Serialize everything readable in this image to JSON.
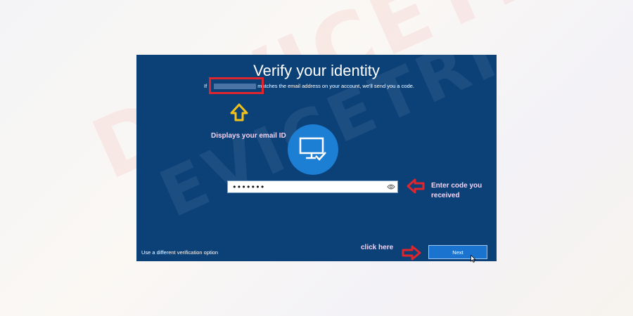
{
  "page": {
    "watermark": "DEVICETRICKS",
    "screen_watermark": "EVICETRICKS"
  },
  "dialog": {
    "title": "Verify your identity",
    "subtitle_prefix": "If",
    "subtitle_suffix": "matches the email address on your account, we'll send you a code.",
    "code_value": "•••••••",
    "alt_option": "Use a different verification option",
    "next_label": "Next"
  },
  "annotations": {
    "email_note": "Displays your email ID",
    "code_note": "Enter code you received",
    "click_note": "click here"
  },
  "icons": {
    "center": "monitor-check-icon",
    "field": "eye-icon",
    "up_arrow": "arrow-up-icon",
    "code_arrow": "arrow-left-icon",
    "next_arrow": "arrow-right-icon",
    "pointer": "mouse-cursor-icon"
  },
  "colors": {
    "screen_bg": "#0c4178",
    "circle": "#1c7fd3",
    "button": "#1a73cf",
    "annotation_red": "#e0252c",
    "annotation_yellow": "#f2c21b",
    "annotation_text": "#f4d3f2"
  }
}
